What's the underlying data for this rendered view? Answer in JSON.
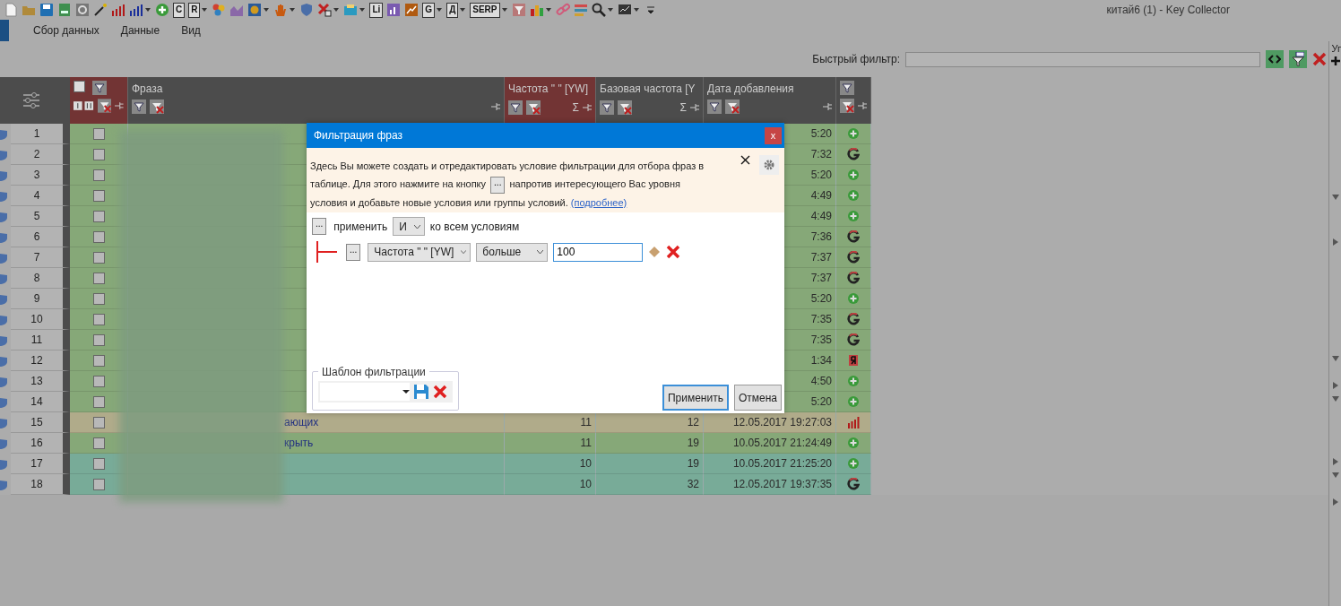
{
  "window": {
    "title": "китай6 (1) - Key Collector"
  },
  "toolbar": [
    {
      "kind": "document",
      "dropdown": false
    },
    {
      "kind": "folder",
      "dropdown": false
    },
    {
      "kind": "save",
      "dropdown": false
    },
    {
      "kind": "spreadsheet",
      "dropdown": false
    },
    {
      "kind": "gear",
      "dropdown": false
    },
    {
      "kind": "wand",
      "dropdown": false
    },
    {
      "kind": "bars-red",
      "dropdown": false
    },
    {
      "kind": "bars-blue",
      "dropdown": true
    },
    {
      "kind": "plus",
      "dropdown": false
    },
    {
      "kind": "letter",
      "label": "C",
      "dropdown": false
    },
    {
      "kind": "letter",
      "label": "R",
      "dropdown": true
    },
    {
      "kind": "dots",
      "dropdown": false
    },
    {
      "kind": "area",
      "dropdown": false
    },
    {
      "kind": "coin",
      "dropdown": true
    },
    {
      "kind": "hand",
      "dropdown": true
    },
    {
      "kind": "shield",
      "dropdown": false
    },
    {
      "kind": "cross",
      "dropdown": true
    },
    {
      "kind": "tray",
      "dropdown": true
    },
    {
      "kind": "letter",
      "label": "Li",
      "dropdown": false
    },
    {
      "kind": "chart-purple",
      "dropdown": false
    },
    {
      "kind": "chart-orange",
      "dropdown": false
    },
    {
      "kind": "letter",
      "label": "G",
      "dropdown": true
    },
    {
      "kind": "letter",
      "label": "Д",
      "dropdown": true
    },
    {
      "kind": "letter",
      "label": "SERP",
      "dropdown": true
    },
    {
      "kind": "funnel",
      "dropdown": false
    },
    {
      "kind": "blocks",
      "dropdown": true
    },
    {
      "kind": "link",
      "dropdown": false
    },
    {
      "kind": "list",
      "dropdown": false
    },
    {
      "kind": "search",
      "dropdown": true
    },
    {
      "kind": "monitor",
      "dropdown": true
    },
    {
      "kind": "overflow",
      "dropdown": false
    }
  ],
  "menu": [
    {
      "label": "Сбор данных",
      "selected": false
    },
    {
      "label": "Данные",
      "selected": false
    },
    {
      "label": "Вид",
      "selected": false
    }
  ],
  "quick_filter": {
    "label": "Быстрый фильтр:"
  },
  "table": {
    "columns": [
      {
        "kind": "check",
        "highlighted": true
      },
      {
        "kind": "text",
        "title": "Фраза",
        "highlighted": false
      },
      {
        "kind": "number",
        "title": "Частота \" \" [YW]",
        "highlighted": true,
        "sum": "Σ"
      },
      {
        "kind": "number",
        "title": "Базовая частота [Y",
        "highlighted": false,
        "sum": "Σ"
      },
      {
        "kind": "date",
        "title": "Дата добавления",
        "highlighted": false
      },
      {
        "kind": "source",
        "highlighted": false
      }
    ],
    "rows": [
      {
        "number": "1",
        "checked": false,
        "color": "#86a878",
        "date": "5:20",
        "kind": "plus"
      },
      {
        "number": "2",
        "checked": false,
        "color": "#86a878",
        "date": "7:32",
        "kind": "ring"
      },
      {
        "number": "3",
        "checked": false,
        "color": "#86a878",
        "date": "5:20",
        "kind": "plus"
      },
      {
        "number": "4",
        "checked": false,
        "color": "#86a878",
        "date": "4:49",
        "kind": "plus"
      },
      {
        "number": "5",
        "checked": false,
        "color": "#86a878",
        "date": "4:49",
        "kind": "plus"
      },
      {
        "number": "6",
        "checked": false,
        "color": "#86a878",
        "date": "7:36",
        "kind": "ring"
      },
      {
        "number": "7",
        "checked": false,
        "color": "#86a878",
        "date": "7:37",
        "kind": "ring"
      },
      {
        "number": "8",
        "checked": false,
        "color": "#86a878",
        "date": "7:37",
        "kind": "ring"
      },
      {
        "number": "9",
        "checked": false,
        "color": "#86a878",
        "date": "5:20",
        "kind": "plus"
      },
      {
        "number": "10",
        "checked": false,
        "color": "#86a878",
        "date": "7:35",
        "kind": "ring"
      },
      {
        "number": "11",
        "checked": false,
        "color": "#86a878",
        "date": "7:35",
        "kind": "ring"
      },
      {
        "number": "12",
        "checked": false,
        "color": "#86a878",
        "date": "1:34",
        "kind": "mark"
      },
      {
        "number": "13",
        "checked": false,
        "color": "#86a878",
        "date": "4:50",
        "kind": "plus"
      },
      {
        "number": "14",
        "checked": false,
        "color": "#86a878",
        "date": "5:20",
        "kind": "plus"
      },
      {
        "number": "15",
        "checked": false,
        "color": "#b0ab8a",
        "phrase": "ающих",
        "freq": "11",
        "base": "12",
        "date": "12.05.2017 19:27:03",
        "kind": "bars"
      },
      {
        "number": "16",
        "checked": false,
        "color": "#86a878",
        "phrase": "крыть",
        "freq": "11",
        "base": "19",
        "date": "10.05.2017 21:24:49",
        "kind": "plus"
      },
      {
        "number": "17",
        "checked": false,
        "color": "#78ab98",
        "freq": "10",
        "base": "19",
        "date": "10.05.2017 21:25:20",
        "kind": "plus"
      },
      {
        "number": "18",
        "checked": false,
        "color": "#78ab98",
        "freq": "10",
        "base": "32",
        "date": "12.05.2017 19:37:35",
        "kind": "ring"
      }
    ]
  },
  "side_panel": {
    "title": "Уп"
  },
  "dialog": {
    "title": "Фильтрация фраз",
    "close": "x",
    "info": {
      "before": "Здесь Вы можете создать и отредактировать условие фильтрации для отбора фраз в таблице. Для этого нажмите на кнопку",
      "button": "...",
      "after": "напротив интересующего Вас уровня условия и добавьте новые условия или группы условий.",
      "link": "(подробнее)"
    },
    "group": {
      "button": "...",
      "label": "применить",
      "operator": "И",
      "suffix": "ко всем условиям"
    },
    "conditions": [
      {
        "button": "...",
        "field": "Частота \" \" [YW]",
        "operator": "больше",
        "value": "100"
      }
    ],
    "template": {
      "legend": "Шаблон фильтрации"
    },
    "buttons": [
      {
        "label": "Применить",
        "focused": true
      },
      {
        "label": "Отмена",
        "focused": false
      }
    ]
  }
}
